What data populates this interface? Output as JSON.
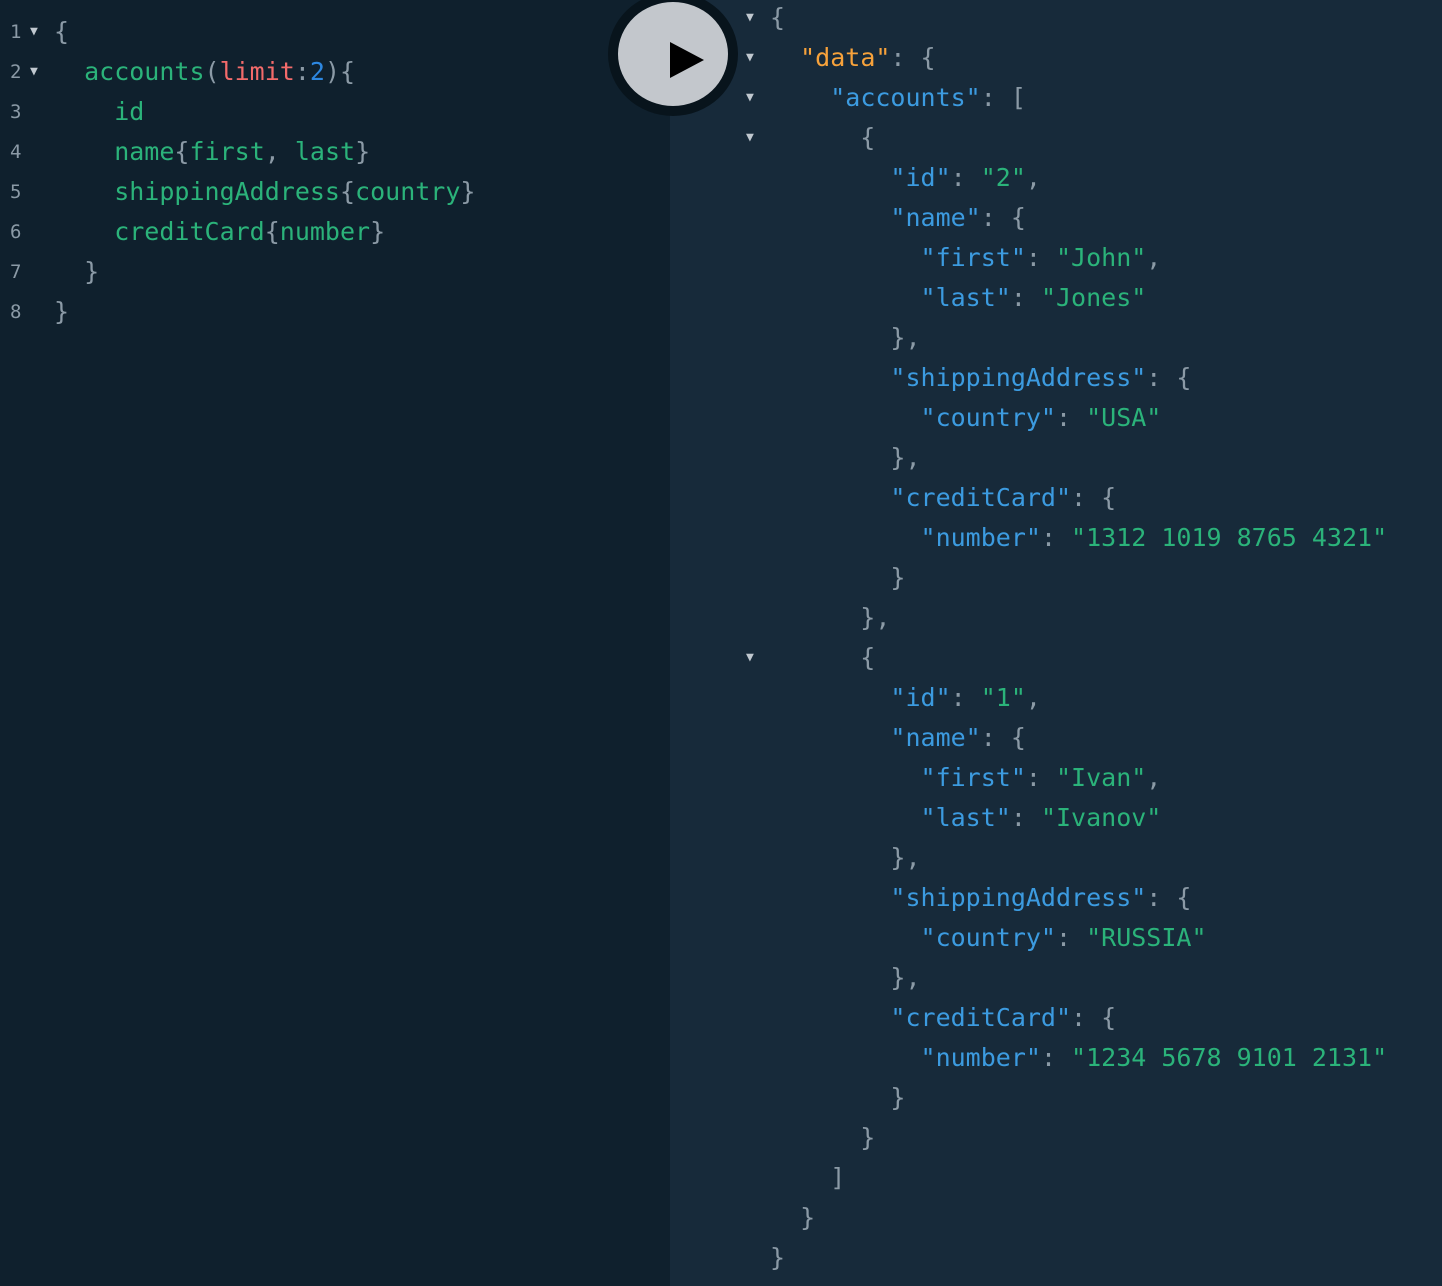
{
  "editor": {
    "lines": [
      {
        "num": "1",
        "tokens": [
          {
            "t": "{",
            "c": "p"
          }
        ]
      },
      {
        "num": "2",
        "tokens": [
          {
            "t": "  accounts",
            "c": "f"
          },
          {
            "t": "(",
            "c": "p"
          },
          {
            "t": "limit",
            "c": "a"
          },
          {
            "t": ":",
            "c": "p"
          },
          {
            "t": "2",
            "c": "n"
          },
          {
            "t": "){",
            "c": "p"
          }
        ]
      },
      {
        "num": "3",
        "tokens": [
          {
            "t": "    id",
            "c": "f"
          }
        ]
      },
      {
        "num": "4",
        "tokens": [
          {
            "t": "    name",
            "c": "f"
          },
          {
            "t": "{",
            "c": "p"
          },
          {
            "t": "first",
            "c": "f"
          },
          {
            "t": ", ",
            "c": "p"
          },
          {
            "t": "last",
            "c": "f"
          },
          {
            "t": "}",
            "c": "p"
          }
        ]
      },
      {
        "num": "5",
        "tokens": [
          {
            "t": "    shippingAddress",
            "c": "f"
          },
          {
            "t": "{",
            "c": "p"
          },
          {
            "t": "country",
            "c": "f"
          },
          {
            "t": "}",
            "c": "p"
          }
        ]
      },
      {
        "num": "6",
        "tokens": [
          {
            "t": "    creditCard",
            "c": "f"
          },
          {
            "t": "{",
            "c": "p"
          },
          {
            "t": "number",
            "c": "f"
          },
          {
            "t": "}",
            "c": "p"
          }
        ]
      },
      {
        "num": "7",
        "tokens": [
          {
            "t": "  }",
            "c": "p"
          }
        ]
      },
      {
        "num": "8",
        "tokens": [
          {
            "t": "}",
            "c": "p"
          }
        ]
      }
    ],
    "foldable": [
      true,
      true,
      false,
      false,
      false,
      false,
      false,
      false
    ]
  },
  "run_button": {
    "icon": "play-icon"
  },
  "result": {
    "lines": [
      {
        "fold": true,
        "tokens": [
          {
            "t": "{",
            "c": "p"
          }
        ]
      },
      {
        "fold": true,
        "tokens": [
          {
            "t": "  ",
            "c": "p"
          },
          {
            "t": "\"data\"",
            "c": "dk"
          },
          {
            "t": ": {",
            "c": "p"
          }
        ]
      },
      {
        "fold": true,
        "tokens": [
          {
            "t": "    ",
            "c": "p"
          },
          {
            "t": "\"accounts\"",
            "c": "k"
          },
          {
            "t": ": [",
            "c": "p"
          }
        ]
      },
      {
        "fold": true,
        "tokens": [
          {
            "t": "      {",
            "c": "p"
          }
        ]
      },
      {
        "fold": false,
        "tokens": [
          {
            "t": "        ",
            "c": "p"
          },
          {
            "t": "\"id\"",
            "c": "k"
          },
          {
            "t": ": ",
            "c": "p"
          },
          {
            "t": "\"2\"",
            "c": "s"
          },
          {
            "t": ",",
            "c": "p"
          }
        ]
      },
      {
        "fold": false,
        "tokens": [
          {
            "t": "        ",
            "c": "p"
          },
          {
            "t": "\"name\"",
            "c": "k"
          },
          {
            "t": ": {",
            "c": "p"
          }
        ]
      },
      {
        "fold": false,
        "tokens": [
          {
            "t": "          ",
            "c": "p"
          },
          {
            "t": "\"first\"",
            "c": "k"
          },
          {
            "t": ": ",
            "c": "p"
          },
          {
            "t": "\"John\"",
            "c": "s"
          },
          {
            "t": ",",
            "c": "p"
          }
        ]
      },
      {
        "fold": false,
        "tokens": [
          {
            "t": "          ",
            "c": "p"
          },
          {
            "t": "\"last\"",
            "c": "k"
          },
          {
            "t": ": ",
            "c": "p"
          },
          {
            "t": "\"Jones\"",
            "c": "s"
          }
        ]
      },
      {
        "fold": false,
        "tokens": [
          {
            "t": "        },",
            "c": "p"
          }
        ]
      },
      {
        "fold": false,
        "tokens": [
          {
            "t": "        ",
            "c": "p"
          },
          {
            "t": "\"shippingAddress\"",
            "c": "k"
          },
          {
            "t": ": {",
            "c": "p"
          }
        ]
      },
      {
        "fold": false,
        "tokens": [
          {
            "t": "          ",
            "c": "p"
          },
          {
            "t": "\"country\"",
            "c": "k"
          },
          {
            "t": ": ",
            "c": "p"
          },
          {
            "t": "\"USA\"",
            "c": "s"
          }
        ]
      },
      {
        "fold": false,
        "tokens": [
          {
            "t": "        },",
            "c": "p"
          }
        ]
      },
      {
        "fold": false,
        "tokens": [
          {
            "t": "        ",
            "c": "p"
          },
          {
            "t": "\"creditCard\"",
            "c": "k"
          },
          {
            "t": ": {",
            "c": "p"
          }
        ]
      },
      {
        "fold": false,
        "tokens": [
          {
            "t": "          ",
            "c": "p"
          },
          {
            "t": "\"number\"",
            "c": "k"
          },
          {
            "t": ": ",
            "c": "p"
          },
          {
            "t": "\"1312 1019 8765 4321\"",
            "c": "s"
          }
        ]
      },
      {
        "fold": false,
        "tokens": [
          {
            "t": "        }",
            "c": "p"
          }
        ]
      },
      {
        "fold": false,
        "tokens": [
          {
            "t": "      },",
            "c": "p"
          }
        ]
      },
      {
        "fold": true,
        "tokens": [
          {
            "t": "      {",
            "c": "p"
          }
        ]
      },
      {
        "fold": false,
        "tokens": [
          {
            "t": "        ",
            "c": "p"
          },
          {
            "t": "\"id\"",
            "c": "k"
          },
          {
            "t": ": ",
            "c": "p"
          },
          {
            "t": "\"1\"",
            "c": "s"
          },
          {
            "t": ",",
            "c": "p"
          }
        ]
      },
      {
        "fold": false,
        "tokens": [
          {
            "t": "        ",
            "c": "p"
          },
          {
            "t": "\"name\"",
            "c": "k"
          },
          {
            "t": ": {",
            "c": "p"
          }
        ]
      },
      {
        "fold": false,
        "tokens": [
          {
            "t": "          ",
            "c": "p"
          },
          {
            "t": "\"first\"",
            "c": "k"
          },
          {
            "t": ": ",
            "c": "p"
          },
          {
            "t": "\"Ivan\"",
            "c": "s"
          },
          {
            "t": ",",
            "c": "p"
          }
        ]
      },
      {
        "fold": false,
        "tokens": [
          {
            "t": "          ",
            "c": "p"
          },
          {
            "t": "\"last\"",
            "c": "k"
          },
          {
            "t": ": ",
            "c": "p"
          },
          {
            "t": "\"Ivanov\"",
            "c": "s"
          }
        ]
      },
      {
        "fold": false,
        "tokens": [
          {
            "t": "        },",
            "c": "p"
          }
        ]
      },
      {
        "fold": false,
        "tokens": [
          {
            "t": "        ",
            "c": "p"
          },
          {
            "t": "\"shippingAddress\"",
            "c": "k"
          },
          {
            "t": ": {",
            "c": "p"
          }
        ]
      },
      {
        "fold": false,
        "tokens": [
          {
            "t": "          ",
            "c": "p"
          },
          {
            "t": "\"country\"",
            "c": "k"
          },
          {
            "t": ": ",
            "c": "p"
          },
          {
            "t": "\"RUSSIA\"",
            "c": "s"
          }
        ]
      },
      {
        "fold": false,
        "tokens": [
          {
            "t": "        },",
            "c": "p"
          }
        ]
      },
      {
        "fold": false,
        "tokens": [
          {
            "t": "        ",
            "c": "p"
          },
          {
            "t": "\"creditCard\"",
            "c": "k"
          },
          {
            "t": ": {",
            "c": "p"
          }
        ]
      },
      {
        "fold": false,
        "tokens": [
          {
            "t": "          ",
            "c": "p"
          },
          {
            "t": "\"number\"",
            "c": "k"
          },
          {
            "t": ": ",
            "c": "p"
          },
          {
            "t": "\"1234 5678 9101 2131\"",
            "c": "s"
          }
        ]
      },
      {
        "fold": false,
        "tokens": [
          {
            "t": "        }",
            "c": "p"
          }
        ]
      },
      {
        "fold": false,
        "tokens": [
          {
            "t": "      }",
            "c": "p"
          }
        ]
      },
      {
        "fold": false,
        "tokens": [
          {
            "t": "    ]",
            "c": "p"
          }
        ]
      },
      {
        "fold": false,
        "tokens": [
          {
            "t": "  }",
            "c": "p"
          }
        ]
      },
      {
        "fold": false,
        "tokens": [
          {
            "t": "}",
            "c": "p"
          }
        ]
      }
    ]
  },
  "colors": {
    "editor_bg": "#0f202d",
    "result_bg": "#172a3a",
    "field": "#2bb37a",
    "argument": "#f36b6b",
    "number": "#2d87e0",
    "json_key": "#3c9be0",
    "data_key": "#f7a23b",
    "punctuation": "#8b9aa6"
  }
}
